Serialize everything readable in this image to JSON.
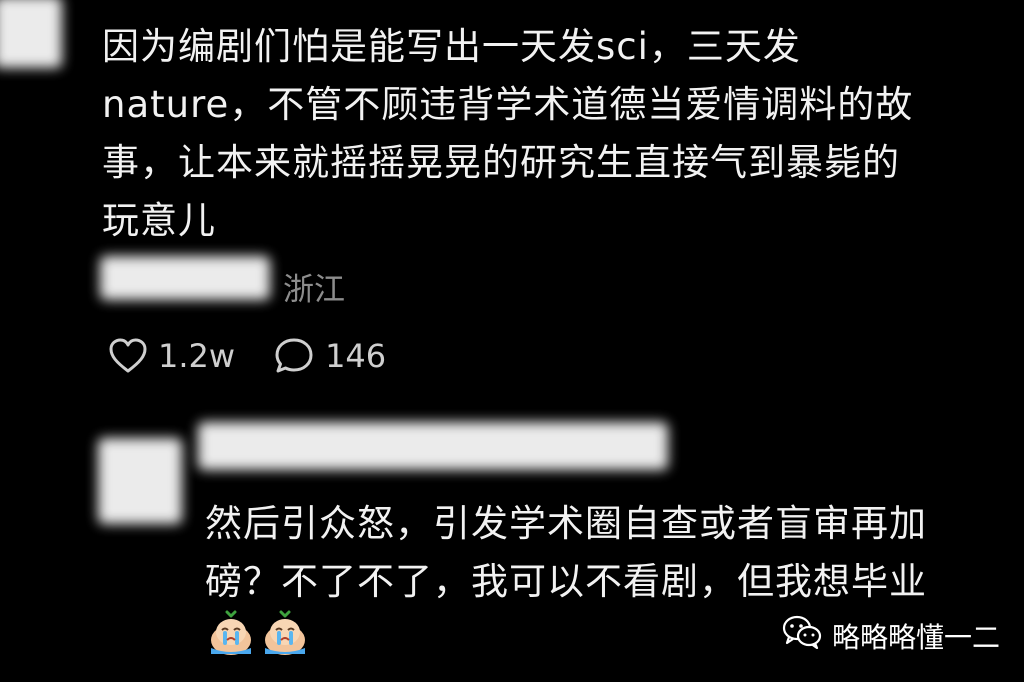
{
  "comment1": {
    "lines": [
      "因为编剧们怕是能写出一天发sci，三天发",
      "nature，不管不顾违背学术道德当爱情调料的故",
      "事，让本来就摇摇晃晃的研究生直接气到暴毙的",
      "玩意儿"
    ],
    "location": "浙江",
    "likes": "1.2w",
    "comments": "146"
  },
  "comment2": {
    "lines": [
      "然后引众怒，引发学术圈自查或者盲审再加",
      "磅？不了不了，我可以不看剧，但我想毕业"
    ],
    "emoji_icon": "crying-emoji-icon"
  },
  "watermark": {
    "icon": "wechat-icon",
    "text": "略略略懂一二"
  },
  "colors": {
    "background": "#000000",
    "text": "#f2f2f2",
    "meta": "#8d8d8d"
  }
}
